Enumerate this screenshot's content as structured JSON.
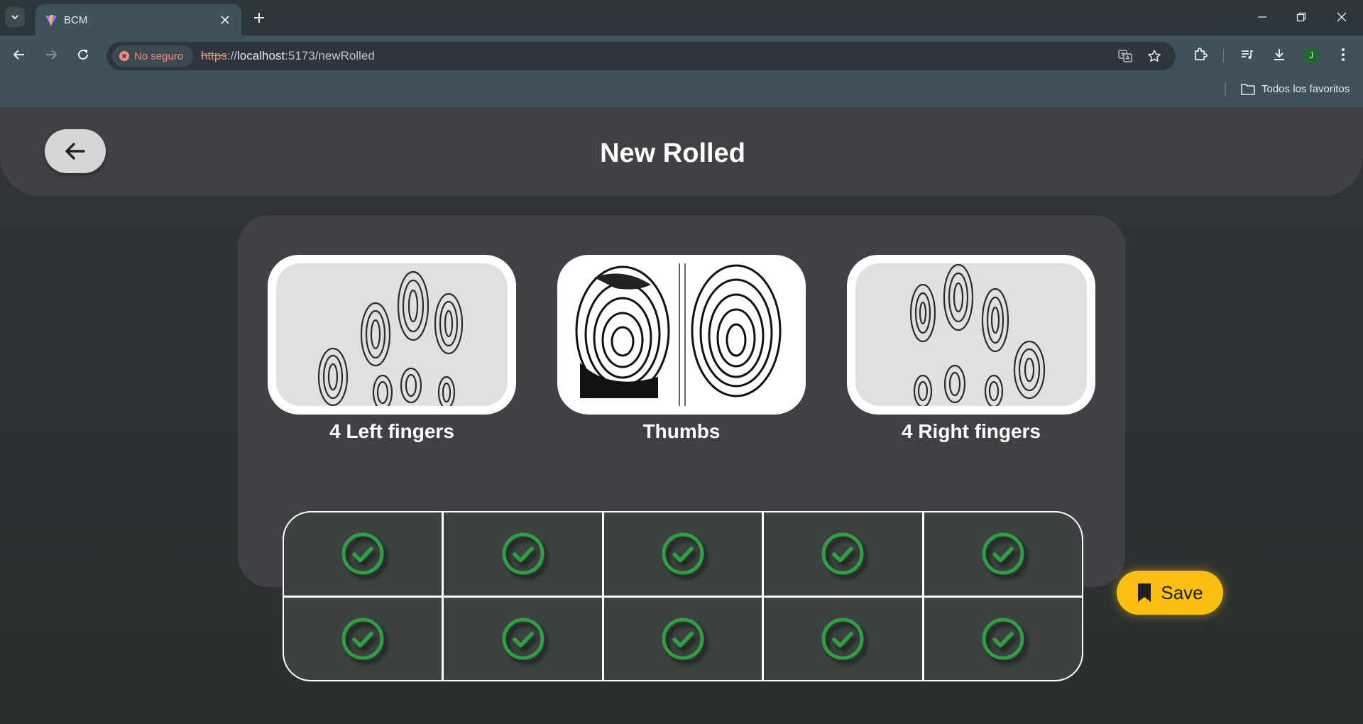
{
  "browser": {
    "tab_title": "BCM",
    "security_label": "No seguro",
    "url_scheme": "https",
    "url_sep": "://",
    "url_host": "localhost",
    "url_rest": ":5173/newRolled",
    "profile_initial": "J",
    "bookmarks_folder_label": "Todos los favoritos"
  },
  "page": {
    "title": "New Rolled",
    "back_icon": "arrow-left-icon",
    "cards": [
      {
        "label": "4 Left fingers",
        "icon": "left-fingers-image"
      },
      {
        "label": "Thumbs",
        "icon": "thumbs-image"
      },
      {
        "label": "4 Right fingers",
        "icon": "right-fingers-image"
      }
    ],
    "finger_grid": {
      "rows": 2,
      "cols": 5,
      "status_icon": "check-circle-icon",
      "status_color": "#2ea043"
    },
    "save_label": "Save",
    "save_icon": "bookmark-icon",
    "colors": {
      "save_button": "#fbbf0f",
      "panel": "#3f4144",
      "cell": "#3c423f"
    }
  }
}
